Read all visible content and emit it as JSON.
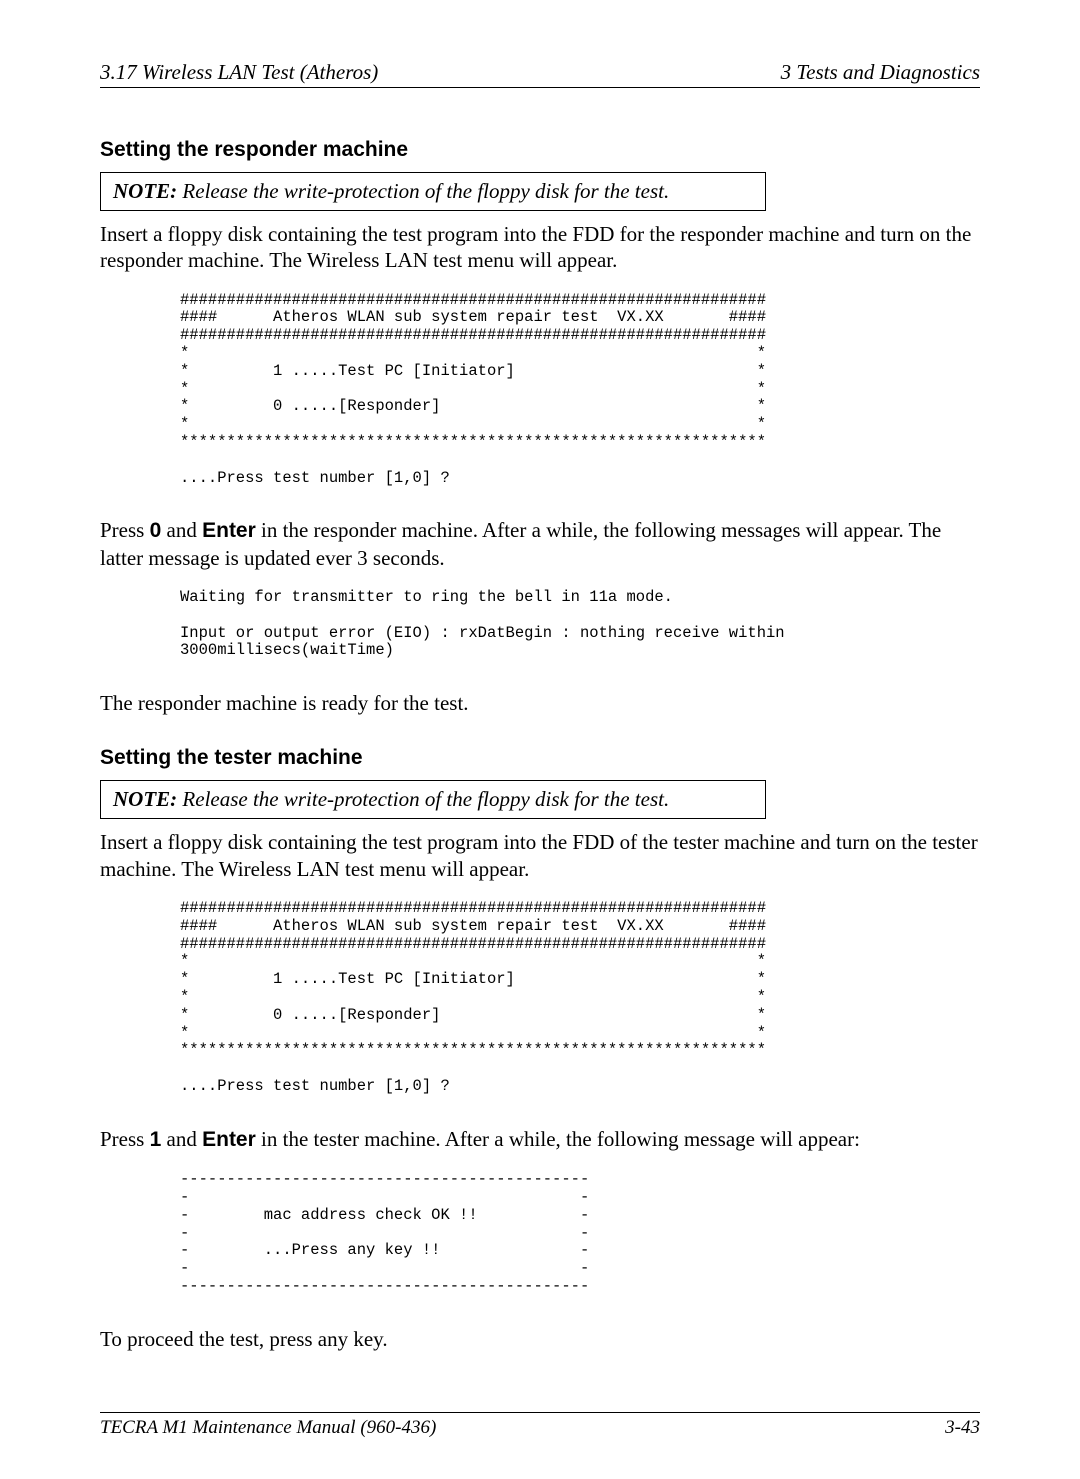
{
  "header": {
    "left": "3.17  Wireless LAN Test  (Atheros)",
    "right": "3   Tests and Diagnostics"
  },
  "sec1": {
    "title": "Setting the responder machine",
    "note_label": "NOTE:",
    "note_text": "  Release the write-protection of the floppy disk for the test.",
    "intro": "Insert a floppy disk containing the test program into the FDD for the responder machine and turn on the responder machine. The Wireless LAN test menu will appear.",
    "code": "###############################################################\n####      Atheros WLAN sub system repair test  VX.XX       ####\n###############################################################\n*                                                             *\n*         1 .....Test PC [Initiator]                          *\n*                                                             *\n*         0 .....[Responder]                                  *\n*                                                             *\n***************************************************************\n\n....Press test number [1,0] ?",
    "press_pre": "Press ",
    "key0": "0",
    "mid1": " and ",
    "enter": "Enter",
    "press_post": " in the responder machine. After a while, the following messages will appear. The latter message is updated ever 3 seconds.",
    "code2": "Waiting for transmitter to ring the bell in 11a mode.\n\nInput or output error (EIO) : rxDatBegin : nothing receive within\n3000millisecs(waitTime)",
    "ready": "The responder machine is ready for the test."
  },
  "sec2": {
    "title": "Setting the tester machine",
    "note_label": "NOTE:",
    "note_text": "  Release the write-protection of the floppy disk for the test.",
    "intro": "Insert a floppy disk containing the test program into the FDD of the tester machine and turn on the tester machine. The Wireless LAN test menu will appear.",
    "code": "###############################################################\n####      Atheros WLAN sub system repair test  VX.XX       ####\n###############################################################\n*                                                             *\n*         1 .....Test PC [Initiator]                          *\n*                                                             *\n*         0 .....[Responder]                                  *\n*                                                             *\n***************************************************************\n\n....Press test number [1,0] ?",
    "press_pre": "Press ",
    "key1": "1",
    "mid1": " and ",
    "enter": "Enter",
    "press_post": " in the tester machine. After a while, the following message will appear:",
    "code2": "--------------------------------------------\n-                                          -\n-        mac address check OK !!           -\n-                                          -\n-        ...Press any key !!               -\n-                                          -\n--------------------------------------------",
    "proceed": "To proceed the test, press any key."
  },
  "footer": {
    "left": "TECRA M1 Maintenance Manual (960-436)",
    "right": "3-43"
  }
}
